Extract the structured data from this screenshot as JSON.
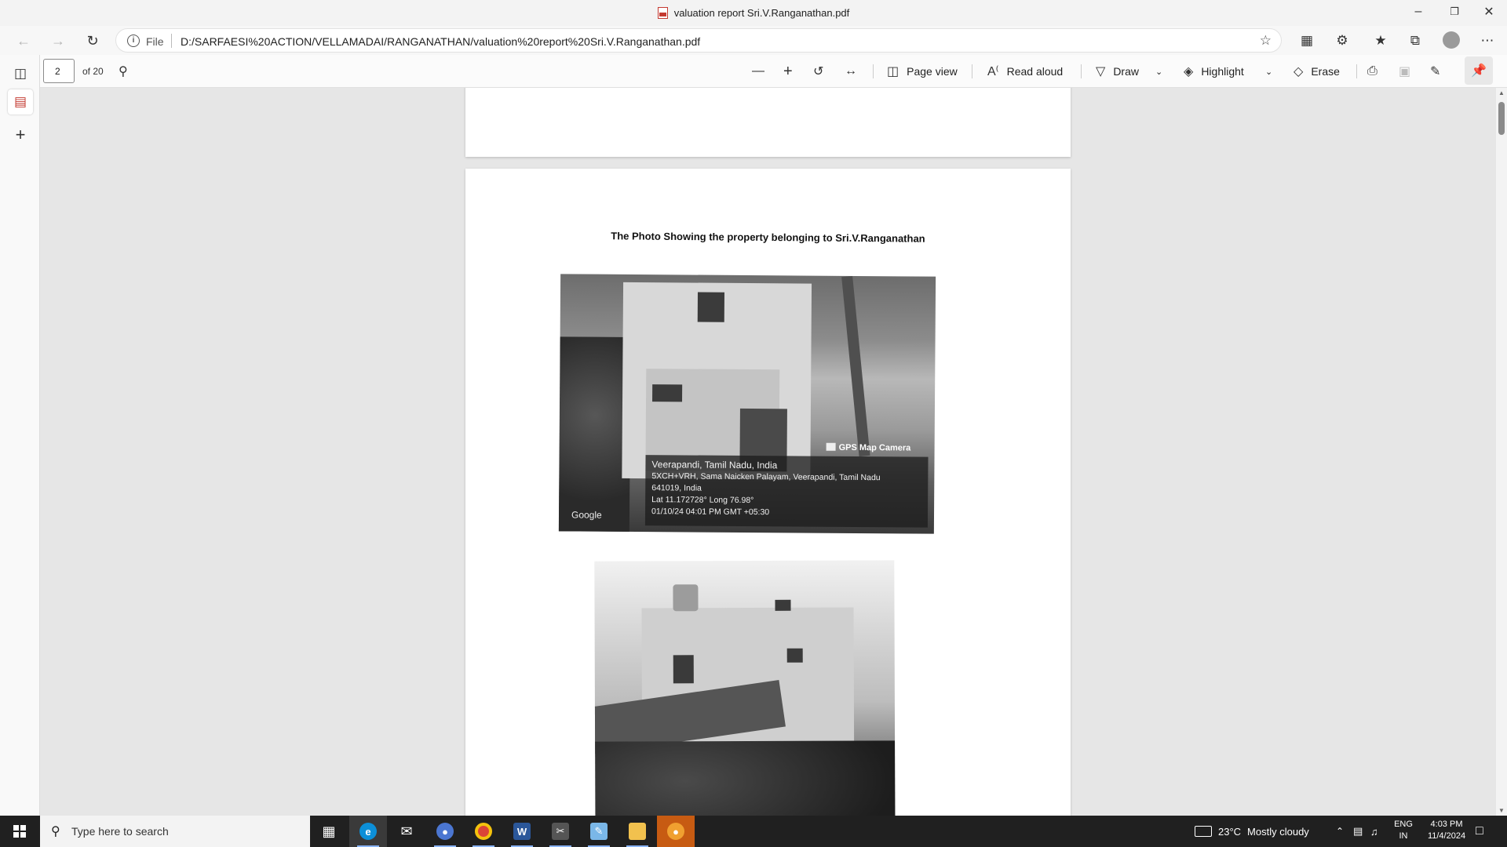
{
  "window": {
    "title": "valuation report Sri.V.Ranganathan.pdf"
  },
  "address_bar": {
    "scheme_label": "File",
    "url": "D:/SARFAESI%20ACTION/VELLAMADAI/RANGANATHAN/valuation%20report%20Sri.V.Ranganathan.pdf"
  },
  "pdf_toolbar": {
    "page_number": "2",
    "page_count": "of 20",
    "page_view": "Page view",
    "read_aloud": "Read aloud",
    "draw": "Draw",
    "highlight": "Highlight",
    "erase": "Erase"
  },
  "document": {
    "heading": "The Photo Showing the property belonging to Sri.V.Ranganathan",
    "photo1": {
      "camera_label": "GPS Map Camera",
      "location": "Veerapandi, Tamil Nadu, India",
      "address_line1": "5XCH+VRH, Sama Naicken Palayam, Veerapandi, Tamil Nadu",
      "address_line2": "641019, India",
      "coordinates": "Lat 11.172728° Long 76.98°",
      "timestamp": "01/10/24 04:01 PM GMT +05:30",
      "map_brand": "Google"
    }
  },
  "taskbar": {
    "search_placeholder": "Type here to search",
    "weather_temp": "23°C",
    "weather_desc": "Mostly cloudy",
    "lang_line1": "ENG",
    "lang_line2": "IN",
    "time": "4:03 PM",
    "date": "11/4/2024"
  },
  "colors": {
    "taskbar_bg": "#202020",
    "accent": "#0078d4",
    "pdf_red": "#c43a31"
  }
}
